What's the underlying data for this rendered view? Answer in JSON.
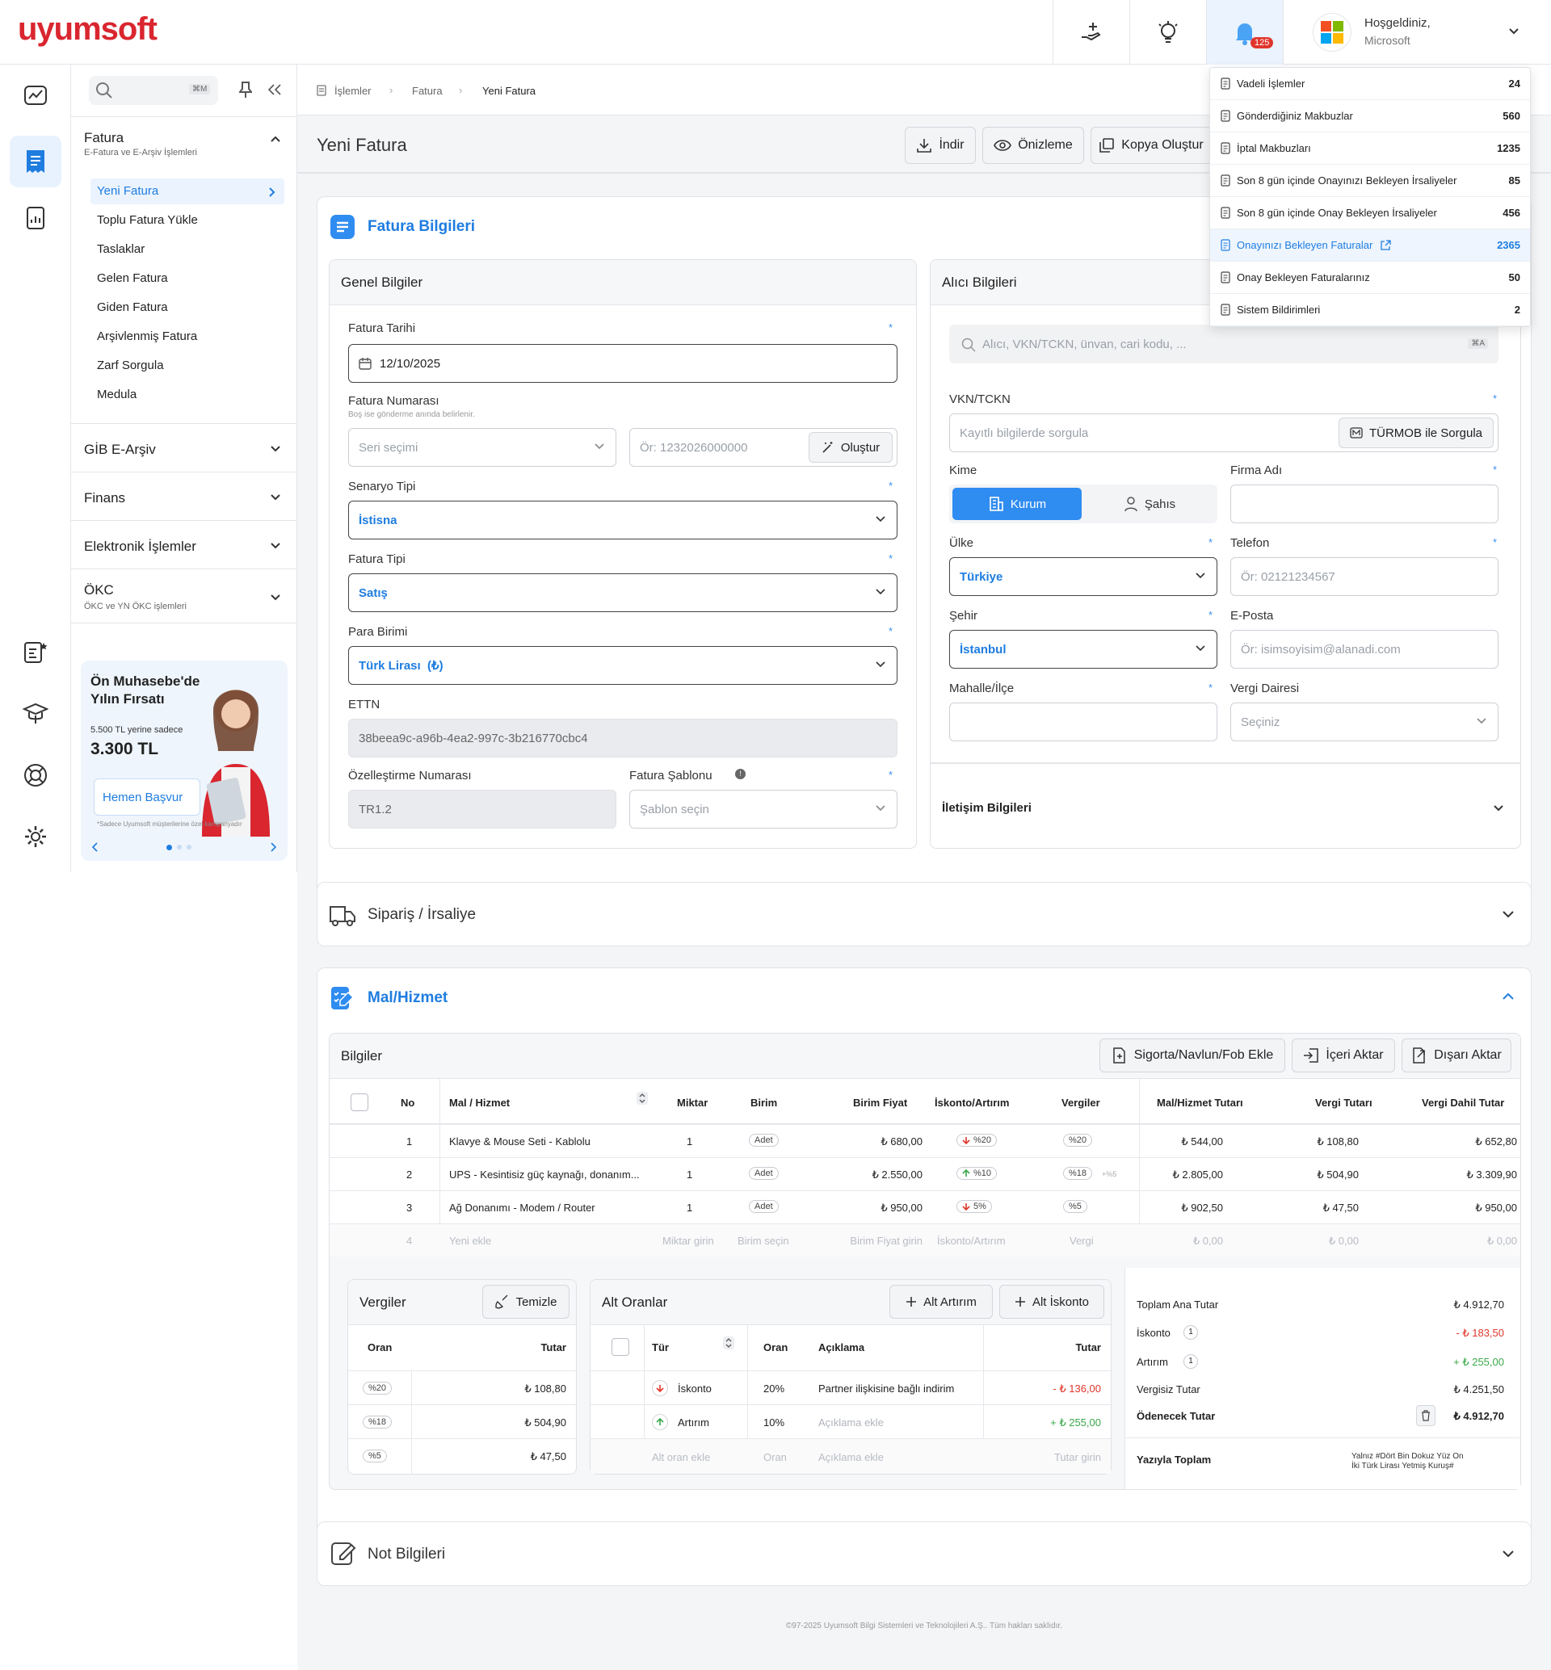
{
  "header": {
    "logo": "uyumsoft",
    "notif_count": "125",
    "welcome": "Hoşgeldiniz,",
    "company": "Microsoft"
  },
  "search": {
    "kbd": "⌘M"
  },
  "sidebar": {
    "fatura": {
      "title": "Fatura",
      "subtitle": "E-Fatura ve E-Arşiv İşlemleri",
      "items": [
        "Yeni Fatura",
        "Toplu Fatura Yükle",
        "Taslaklar",
        "Gelen Fatura",
        "Giden Fatura",
        "Arşivlenmiş Fatura",
        "Zarf Sorgula",
        "Medula"
      ]
    },
    "gib": "GİB E-Arşiv",
    "finans": "Finans",
    "elektronik": "Elektronik İşlemler",
    "okc": {
      "title": "ÖKC",
      "subtitle": "ÖKC ve YN ÖKC işlemleri"
    },
    "promo": {
      "title1": "Ön Muhasebe'de",
      "title2": "Yılın Fırsatı",
      "old": "5.500 TL yerine sadece",
      "price": "3.300 TL",
      "button": "Hemen Başvur",
      "note": "*Sadece Uyumsoft müşterilerine özel kampanyadır"
    }
  },
  "breadcrumb": [
    "İşlemler",
    "Fatura",
    "Yeni Fatura"
  ],
  "page": {
    "title": "Yeni Fatura",
    "actions": [
      "İndir",
      "Önizleme",
      "Kopya Oluştur"
    ]
  },
  "fatura_bilgileri": {
    "title": "Fatura Bilgileri",
    "genel": {
      "title": "Genel Bilgiler",
      "tarih_label": "Fatura Tarihi",
      "tarih": "12/10/2025",
      "no_label": "Fatura Numarası",
      "no_hint": "Boş ise gönderme anında belirlenir.",
      "seri_ph": "Seri seçimi",
      "no_ph": "Ör: 1232026000000",
      "olustur": "Oluştur",
      "senaryo_label": "Senaryo Tipi",
      "senaryo": "İstisna",
      "tip_label": "Fatura Tipi",
      "tip": "Satış",
      "para_label": "Para Birimi",
      "para": "Türk Lirası  (₺)",
      "ettn_label": "ETTN",
      "ettn": "38beea9c-a96b-4ea2-997c-3b216770cbc4",
      "ozel_label": "Özelleştirme Numarası",
      "ozel": "TR1.2",
      "sablon_label": "Fatura Şablonu",
      "sablon_ph": "Şablon seçin"
    },
    "alici": {
      "title": "Alıcı Bilgileri",
      "search_ph": "Alıcı, VKN/TCKN, ünvan, cari kodu, ...",
      "search_kbd": "⌘A",
      "vkn_label": "VKN/TCKN",
      "vkn_ph": "Kayıtlı bilgilerde sorgula",
      "turmob": "TÜRMOB ile Sorgula",
      "kime_label": "Kime",
      "kurum": "Kurum",
      "sahis": "Şahıs",
      "firma_label": "Firma Adı",
      "ulke_label": "Ülke",
      "ulke": "Türkiye",
      "tel_label": "Telefon",
      "tel_ph": "Ör: 02121234567",
      "sehir_label": "Şehir",
      "sehir": "İstanbul",
      "eposta_label": "E-Posta",
      "eposta_ph": "Ör: isimsoyisim@alanadi.com",
      "mahalle_label": "Mahalle/İlçe",
      "vd_label": "Vergi Dairesi",
      "vd_ph": "Seçiniz",
      "iletisim": "İletişim Bilgileri"
    }
  },
  "siparis": {
    "title": "Sipariş / İrsaliye"
  },
  "mal": {
    "title": "Mal/Hizmet",
    "bilgiler": "Bilgiler",
    "buttons": [
      "Sigorta/Navlun/Fob Ekle",
      "İçeri Aktar",
      "Dışarı Aktar"
    ],
    "columns": [
      "No",
      "Mal / Hizmet",
      "Miktar",
      "Birim",
      "Birim Fiyat",
      "İskonto/Artırım",
      "Vergiler",
      "Mal/Hizmet Tutarı",
      "Vergi Tutarı",
      "Vergi Dahil Tutar"
    ],
    "rows": [
      {
        "no": "1",
        "name": "Klavye & Mouse Seti - Kablolu",
        "qty": "1",
        "unit": "Adet",
        "price": "₺ 680,00",
        "disc": "%20",
        "disc_dir": "down",
        "tax": "%20",
        "tax2": "",
        "amount": "₺ 544,00",
        "tax_amount": "₺ 108,80",
        "total": "₺ 652,80"
      },
      {
        "no": "2",
        "name": "UPS - Kesintisiz güç kaynağı, donanım...",
        "qty": "1",
        "unit": "Adet",
        "price": "₺ 2.550,00",
        "disc": "%10",
        "disc_dir": "up",
        "tax": "%18",
        "tax2": "+%5",
        "amount": "₺ 2.805,00",
        "tax_amount": "₺ 504,90",
        "total": "₺ 3.309,90"
      },
      {
        "no": "3",
        "name": "Ağ Donanımı - Modem / Router",
        "qty": "1",
        "unit": "Adet",
        "price": "₺ 950,00",
        "disc": "5%",
        "disc_dir": "down",
        "tax": "%5",
        "tax2": "",
        "amount": "₺ 902,50",
        "tax_amount": "₺ 47,50",
        "total": "₺ 950,00"
      }
    ],
    "new_row": {
      "no": "4",
      "name": "Yeni ekle",
      "qty": "Miktar girin",
      "unit": "Birim seçin",
      "price": "Birim Fiyat girin",
      "disc": "İskonto/Artırım",
      "tax": "Vergi",
      "amount": "₺ 0,00",
      "tax_amount": "₺ 0,00",
      "total": "₺ 0,00"
    },
    "vergiler": {
      "title": "Vergiler",
      "clear": "Temizle",
      "col_oran": "Oran",
      "col_tutar": "Tutar",
      "rows": [
        {
          "oran": "%20",
          "tutar": "₺ 108,80"
        },
        {
          "oran": "%18",
          "tutar": "₺ 504,90"
        },
        {
          "oran": "%5",
          "tutar": "₺ 47,50"
        }
      ]
    },
    "alt": {
      "title": "Alt Oranlar",
      "btn_artirim": "Alt Artırım",
      "btn_iskonto": "Alt İskonto",
      "cols": [
        "Tür",
        "Oran",
        "Açıklama",
        "Tutar"
      ],
      "rows": [
        {
          "tur": "İskonto",
          "oran": "20%",
          "aciklama": "Partner ilişkisine bağlı indirim",
          "tutar": "- ₺ 136,00"
        },
        {
          "tur": "Artırım",
          "oran": "10%",
          "aciklama": "Açıklama ekle",
          "tutar": "+ ₺ 255,00"
        }
      ],
      "new": {
        "tur": "Alt oran ekle",
        "oran": "Oran",
        "aciklama": "Açıklama ekle",
        "tutar": "Tutar girin"
      }
    },
    "totals": {
      "ana_l": "Toplam Ana Tutar",
      "ana": "₺ 4.912,70",
      "isk_l": "İskonto",
      "isk_n": "1",
      "isk": "- ₺ 183,50",
      "art_l": "Artırım",
      "art_n": "1",
      "art": "+ ₺ 255,00",
      "vergisiz_l": "Vergisiz Tutar",
      "vergisiz": "₺ 4.251,50",
      "odenecek_l": "Ödenecek Tutar",
      "odenecek": "₺ 4.912,70",
      "yazi_l": "Yazıyla Toplam",
      "yazi1": "Yalnız #Dört Bin Dokuz Yüz On",
      "yazi2": "İki Türk Lirası Yetmiş Kuruş#"
    }
  },
  "not": {
    "title": "Not Bilgileri"
  },
  "footer": "©97-2025 Uyumsoft Bilgi Sistemleri ve Teknolojileri A.Ş.. Tüm hakları saklıdır.",
  "notifications": [
    {
      "label": "Vadeli İşlemler",
      "count": "24"
    },
    {
      "label": "Gönderdiğiniz Makbuzlar",
      "count": "560"
    },
    {
      "label": "İptal Makbuzları",
      "count": "1235"
    },
    {
      "label": "Son 8 gün içinde Onayınızı Bekleyen İrsaliyeler",
      "count": "85"
    },
    {
      "label": "Son 8 gün içinde Onay Bekleyen İrsaliyeler",
      "count": "456"
    },
    {
      "label": "Onayınızı Bekleyen Faturalar",
      "count": "2365"
    },
    {
      "label": "Onay Bekleyen Faturalarınız",
      "count": "50"
    },
    {
      "label": "Sistem Bildirimleri",
      "count": "2"
    }
  ],
  "colors": {
    "brand": "#d9262f",
    "accent": "#1f7de0",
    "danger": "#e0362c",
    "success": "#3aa84a"
  }
}
